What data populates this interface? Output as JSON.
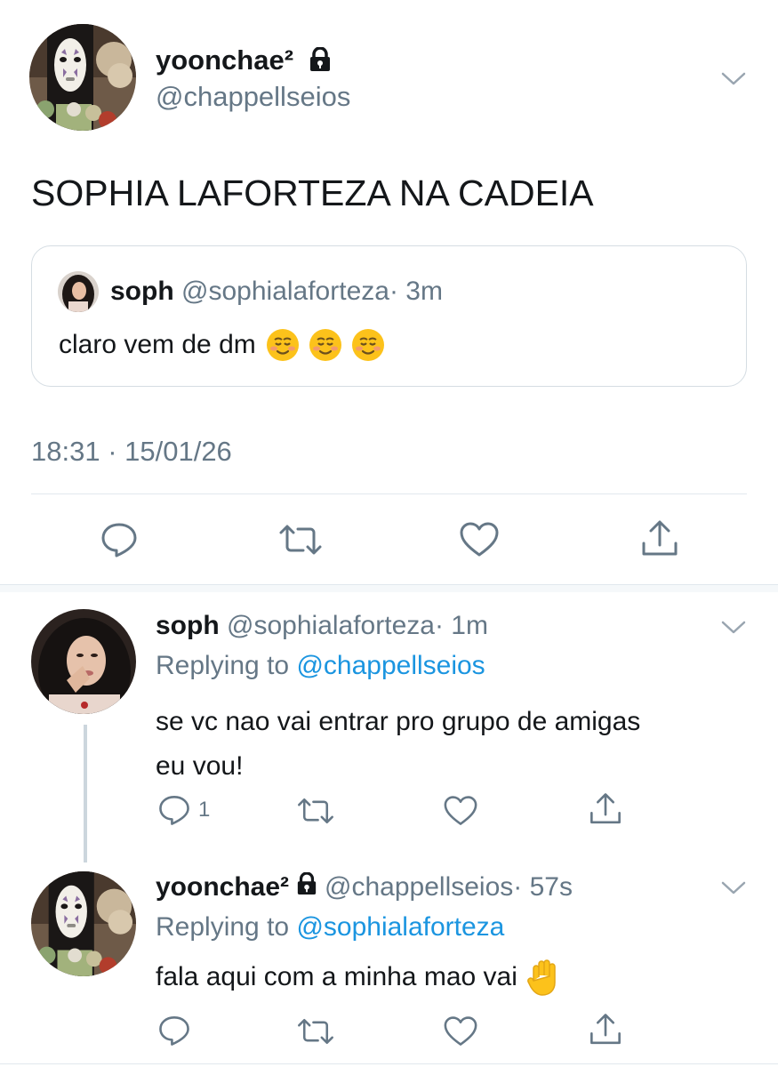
{
  "main_tweet": {
    "display_name": "yoonchae²",
    "handle": "@chappellseios",
    "text": "SOPHIA LAFORTEZA NA CADEIA",
    "timestamp": "18:31 · 15/01/26",
    "quoted": {
      "name": "soph",
      "handle": "@sophialaforteza",
      "time": "· 3m",
      "text": "claro vem de dm",
      "emoji": [
        "smiling-face-icon",
        "smiling-face-icon",
        "smiling-face-icon"
      ]
    }
  },
  "replies": [
    {
      "name": "soph",
      "handle": "@sophialaforteza",
      "time": "· 1m",
      "replying_label": "Replying to",
      "replying_to": "@chappellseios",
      "text_line1": "se vc nao vai entrar pro grupo de amigas",
      "text_line2": "eu vou!",
      "reply_count": "1"
    },
    {
      "name": "yoonchae²",
      "handle": "@chappellseios",
      "time": "· 57s",
      "replying_label": "Replying to",
      "replying_to": "@sophialaforteza",
      "text": "fala aqui com a minha mao vai",
      "emoji": "raised-hand-icon"
    }
  ],
  "colors": {
    "text": "#14171a",
    "secondary": "#657786",
    "link": "#1b95e0",
    "border": "#e1e8ed"
  }
}
